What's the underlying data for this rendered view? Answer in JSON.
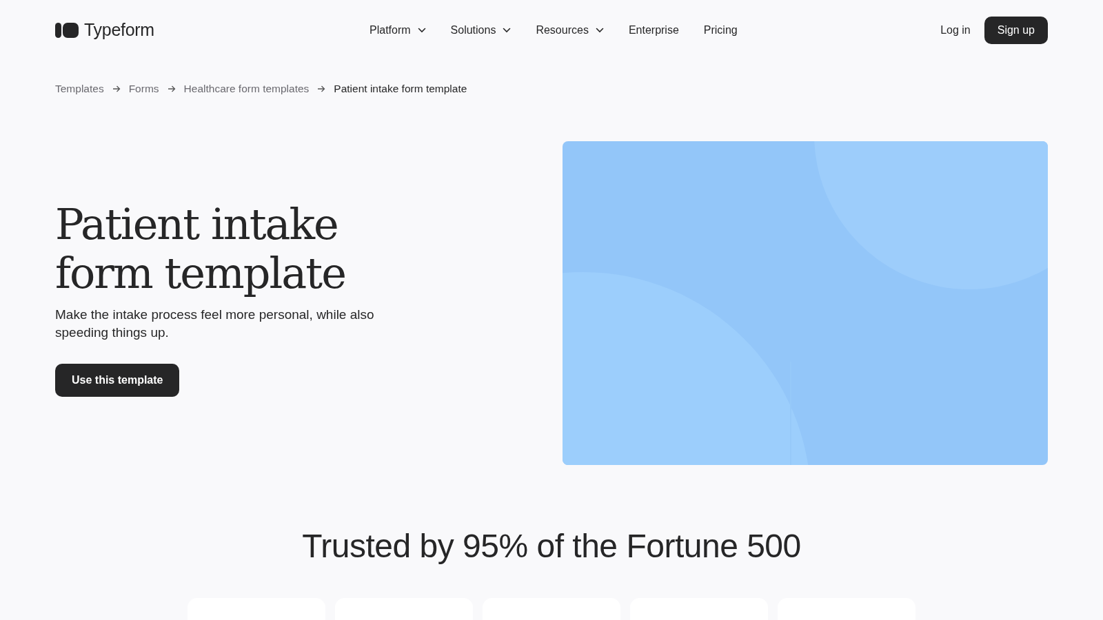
{
  "header": {
    "logo": "Typeform",
    "nav": [
      {
        "label": "Platform",
        "has_menu": true
      },
      {
        "label": "Solutions",
        "has_menu": true
      },
      {
        "label": "Resources",
        "has_menu": true
      },
      {
        "label": "Enterprise",
        "has_menu": false
      },
      {
        "label": "Pricing",
        "has_menu": false
      }
    ],
    "login": "Log in",
    "signup": "Sign up"
  },
  "breadcrumb": [
    {
      "label": "Templates",
      "current": false
    },
    {
      "label": "Forms",
      "current": false
    },
    {
      "label": "Healthcare form templates",
      "current": false
    },
    {
      "label": "Patient intake form template",
      "current": true
    }
  ],
  "hero": {
    "title_lines": [
      "Patient intake",
      "form template"
    ],
    "subtitle": "Make the intake process feel more personal, while also speeding things up.",
    "button": "Use this template"
  },
  "trusted": {
    "heading": "Trusted by 95% of the Fortune 500"
  }
}
